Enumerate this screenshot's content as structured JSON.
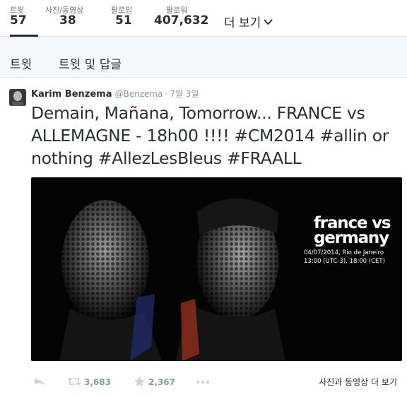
{
  "profile_nav": {
    "stats": [
      {
        "label": "트윗",
        "value": "57",
        "active": true
      },
      {
        "label": "사진/동영상",
        "value": "38"
      },
      {
        "label": "팔로잉",
        "value": "51"
      },
      {
        "label": "팔로워",
        "value": "407,632"
      }
    ],
    "more_label": "더 보기"
  },
  "content_tabs": [
    {
      "label": "트윗",
      "active": true
    },
    {
      "label": "트윗 및 답글"
    }
  ],
  "tweet": {
    "fullname": "Karim Benzema",
    "handle": "@Benzema",
    "separator": "·",
    "time": "7월 3일",
    "text": "Demain, Mañana, Tomorrow...  FRANCE vs ALLEMAGNE - 18h00 !!!! #CM2014 #allin or nothing  #AllezLesBleus #FRAALL",
    "media": {
      "title_line1": "france vs",
      "title_line2": "germany",
      "line1": "04/07/2014, Rio de Janeiro",
      "line2": "13:00 (UTC-3), 18:00 (CET)"
    },
    "retweet_count": "3,683",
    "favorite_count": "2,367",
    "view_media_label": "사진과 동영상 더 보기"
  },
  "colors": {
    "text": "#292f33",
    "muted": "#8899a6",
    "border": "#e1e8ed",
    "tab_background": "#f5f8fa",
    "media_background": "#040404"
  },
  "icons": [
    "chevron-down-icon",
    "reply-icon",
    "retweet-icon",
    "star-icon",
    "more-icon"
  ]
}
